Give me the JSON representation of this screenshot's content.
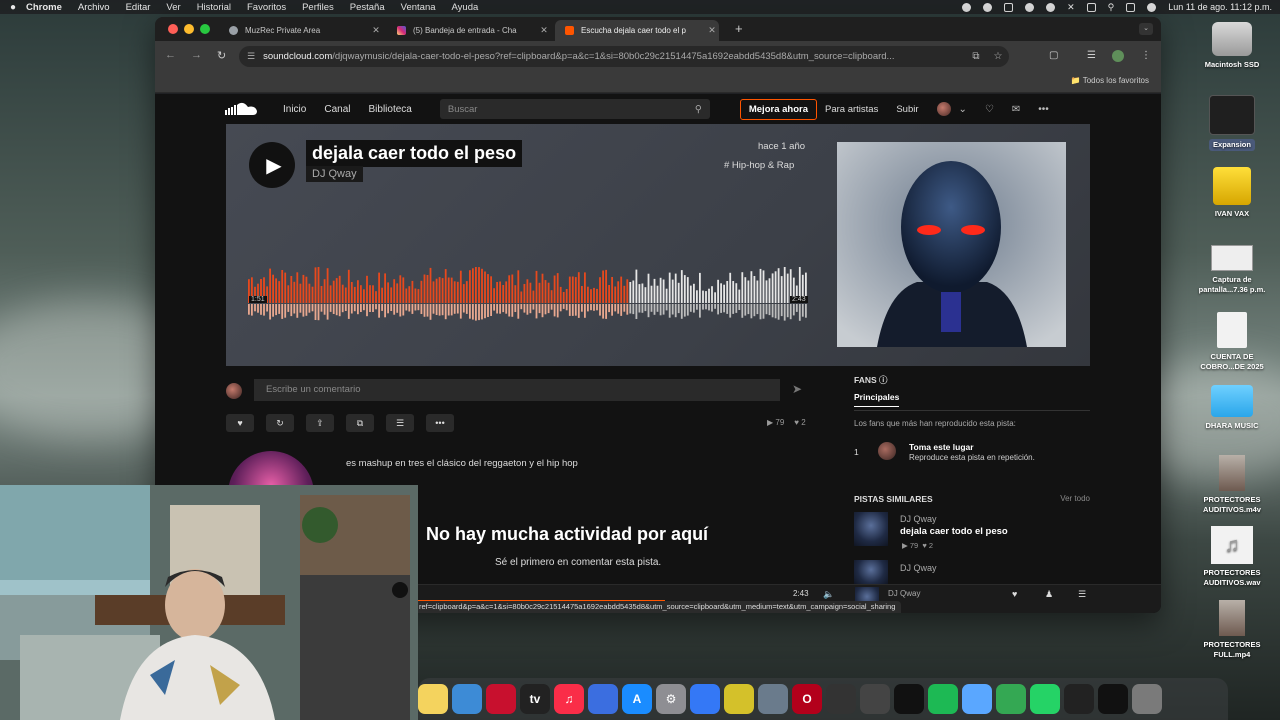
{
  "menubar": {
    "app": "Chrome",
    "items": [
      "Archivo",
      "Editar",
      "Ver",
      "Historial",
      "Favoritos",
      "Perfiles",
      "Pestaña",
      "Ventana",
      "Ayuda"
    ],
    "clock": "Lun 11 de ago.  11:12 p.m."
  },
  "browser": {
    "tabs": [
      {
        "label": "MuzRec Private Area",
        "favicon_color": "#9aa0a6"
      },
      {
        "label": "(5) Bandeja de entrada - Cha",
        "favicon_color": "#d6249f"
      },
      {
        "label": "Escucha dejala caer todo el p",
        "favicon_color": "#ff5500"
      }
    ],
    "url_domain": "soundcloud.com",
    "url_path": "/djqwaymusic/dejala-caer-todo-el-peso?ref=clipboard&p=a&c=1&si=80b0c29c21514475a1692eabdd5435d8&utm_source=clipboard...",
    "bookmarks_label": "Todos los favoritos"
  },
  "soundcloud": {
    "nav": {
      "home": "Inicio",
      "feed": "Canal",
      "library": "Biblioteca",
      "search_placeholder": "Buscar",
      "upgrade": "Mejora ahora",
      "for_artists": "Para artistas",
      "upload": "Subir"
    },
    "track": {
      "title": "dejala caer todo el peso",
      "artist": "DJ Qway",
      "posted": "hace 1 año",
      "tag": "# Hip-hop & Rap",
      "elapsed": "1:51",
      "duration": "2:43",
      "progress": 0.68
    },
    "comment_placeholder": "Escribe un comentario",
    "stats": {
      "plays": "79",
      "likes": "2"
    },
    "description": "es mashup en tres el clásico del reggaeton y el hip hop",
    "empty_title": "No hay mucha actividad por aquí",
    "empty_sub": "Sé el primero en comentar esta pista.",
    "fans": {
      "heading": "FANS",
      "tab": "Principales",
      "note": "Los fans que más han reproducido esta pista:",
      "rank": "1",
      "title": "Toma este lugar",
      "sub": "Reproduce esta pista en repetición."
    },
    "similar": {
      "heading": "PISTAS SIMILARES",
      "view_all": "Ver todo",
      "items": [
        {
          "artist": "DJ Qway",
          "track": "dejala caer todo el peso",
          "plays": "79",
          "likes": "2"
        },
        {
          "artist": "DJ Qway"
        }
      ]
    },
    "player": {
      "time": "2:43",
      "artist": "DJ Qway"
    },
    "status_url": "ref=clipboard&p=a&c=1&si=80b0c29c21514475a1692eabdd5435d8&utm_source=clipboard&utm_medium=text&utm_campaign=social_sharing"
  },
  "desktop": {
    "icons": [
      {
        "label": "Macintosh SSD"
      },
      {
        "label": "Expansion"
      },
      {
        "label": "IVAN VAX"
      },
      {
        "label": "Captura de\npantalla...7.36 p.m."
      },
      {
        "label": "CUENTA DE\nCOBRO...DE 2025"
      },
      {
        "label": "DHARA MUSIC"
      },
      {
        "label": "PROTECTORES\nAUDITIVOS.m4v"
      },
      {
        "label": "PROTECTORES\nAUDITIVOS.wav"
      },
      {
        "label": "PROTECTORES\nFULL.mp4"
      }
    ]
  },
  "dock": {
    "apps": [
      {
        "name": "notes-icon",
        "color": "#f4d35e"
      },
      {
        "name": "freeform-icon",
        "color": "#3d8bd6"
      },
      {
        "name": "davinci-icon",
        "color": "#c8102e"
      },
      {
        "name": "appletv-icon",
        "color": "#222222",
        "glyph": "tv"
      },
      {
        "name": "music-icon",
        "color": "#fa2d48",
        "glyph": "♫"
      },
      {
        "name": "voice-memos-icon",
        "color": "#3b6ee0"
      },
      {
        "name": "app-store-icon",
        "color": "#1a8cff",
        "glyph": "A"
      },
      {
        "name": "settings-icon",
        "color": "#8e8e93",
        "glyph": "⚙"
      },
      {
        "name": "finder-alt-icon",
        "color": "#3478f6"
      },
      {
        "name": "logic-icon",
        "color": "#d4c12a"
      },
      {
        "name": "utility-icon",
        "color": "#6a7b8c"
      },
      {
        "name": "opera-icon",
        "color": "#b3001b",
        "glyph": "O"
      },
      {
        "name": "audio-tool-icon",
        "color": "#333333"
      },
      {
        "name": "instruments-icon",
        "color": "#444444"
      },
      {
        "name": "ableton-icon",
        "color": "#111111"
      },
      {
        "name": "spotify-icon",
        "color": "#1db954"
      },
      {
        "name": "finder-icon",
        "color": "#5aa7ff"
      },
      {
        "name": "chrome-icon",
        "color": "#34a853"
      },
      {
        "name": "whatsapp-icon",
        "color": "#25d366"
      },
      {
        "name": "activity-icon",
        "color": "#222222"
      },
      {
        "name": "capcut-icon",
        "color": "#111111"
      },
      {
        "name": "trash-icon",
        "color": "#7a7a7a"
      }
    ]
  }
}
